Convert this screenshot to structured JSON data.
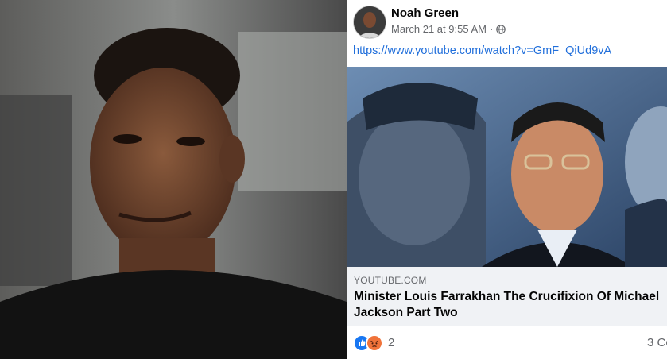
{
  "post": {
    "author": "Noah Green",
    "timestamp": "March 21 at 9:55 AM",
    "separator": "·",
    "privacy_icon": "globe-icon",
    "link_url": "https://www.youtube.com/watch?v=GmF_QiUd9vA",
    "preview": {
      "domain": "YOUTUBE.COM",
      "title": "Minister Louis Farrakhan The Crucifixion Of Michael Jackson Part Two"
    },
    "reactions": {
      "icons": [
        "like-icon",
        "angry-icon"
      ],
      "count": "2"
    },
    "comments": "3 Co"
  },
  "colors": {
    "link": "#216fdb",
    "secondary_text": "#65676b",
    "preview_bg": "#f0f2f5",
    "like": "#1877f2",
    "angry": "#f0733a"
  }
}
